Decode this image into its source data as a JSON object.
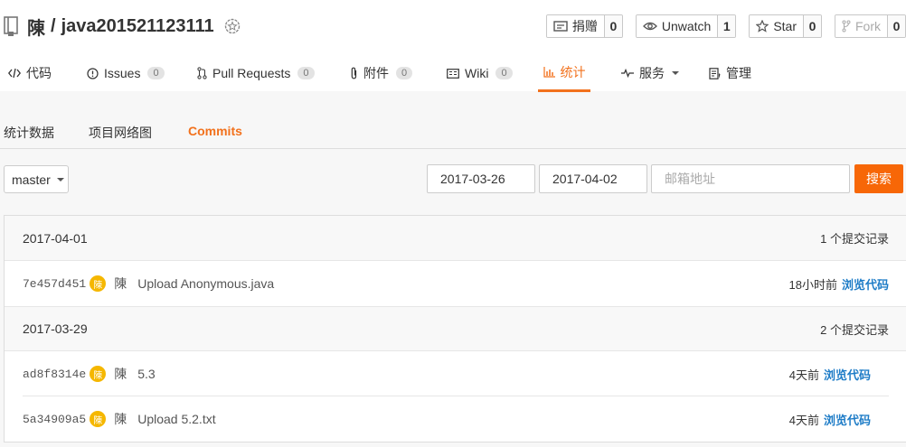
{
  "repo": {
    "owner": "陳",
    "separator": "/",
    "name": "java201521123111"
  },
  "actions": [
    {
      "label": "捐赠",
      "count": "0",
      "icon": "donate-icon"
    },
    {
      "label": "Unwatch",
      "count": "1",
      "icon": "eye-icon"
    },
    {
      "label": "Star",
      "count": "0",
      "icon": "star-icon"
    },
    {
      "label": "Fork",
      "count": "0",
      "icon": "fork-icon"
    }
  ],
  "tabs": [
    {
      "label": "代码",
      "icon": "code-icon"
    },
    {
      "label": "Issues",
      "count": "0",
      "icon": "issue-icon"
    },
    {
      "label": "Pull Requests",
      "count": "0",
      "icon": "pull-request-icon"
    },
    {
      "label": "附件",
      "count": "0",
      "icon": "paperclip-icon"
    },
    {
      "label": "Wiki",
      "count": "0",
      "icon": "wiki-icon"
    },
    {
      "label": "统计",
      "icon": "chart-icon",
      "active": true
    },
    {
      "label": "服务",
      "icon": "pulse-icon"
    },
    {
      "label": "管理",
      "icon": "settings-icon"
    }
  ],
  "subtabs": [
    "统计数据",
    "项目网络图",
    "Commits"
  ],
  "filters": {
    "branch": "master",
    "start_date": "2017-03-26",
    "end_date": "2017-04-02",
    "email_placeholder": "邮箱地址",
    "search_label": "搜索"
  },
  "groups": [
    {
      "date": "2017-04-01",
      "count_label": "1 个提交记录",
      "commits": [
        {
          "sha": "7e457d451",
          "avatar": "陳",
          "author": "陳",
          "message": "Upload Anonymous.java",
          "time": "18小时前",
          "browse": "浏览代码"
        }
      ]
    },
    {
      "date": "2017-03-29",
      "count_label": "2 个提交记录",
      "commits": [
        {
          "sha": "ad8f8314e",
          "avatar": "陳",
          "author": "陳",
          "message": "5.3",
          "time": "4天前",
          "browse": "浏览代码"
        },
        {
          "sha": "5a34909a5",
          "avatar": "陳",
          "author": "陳",
          "message": "Upload 5.2.txt",
          "time": "4天前",
          "browse": "浏览代码"
        }
      ]
    }
  ],
  "colors": {
    "accent": "#f2711c",
    "search_button": "#f76707",
    "link": "#1e7cc7",
    "avatar": "#f5b700"
  }
}
